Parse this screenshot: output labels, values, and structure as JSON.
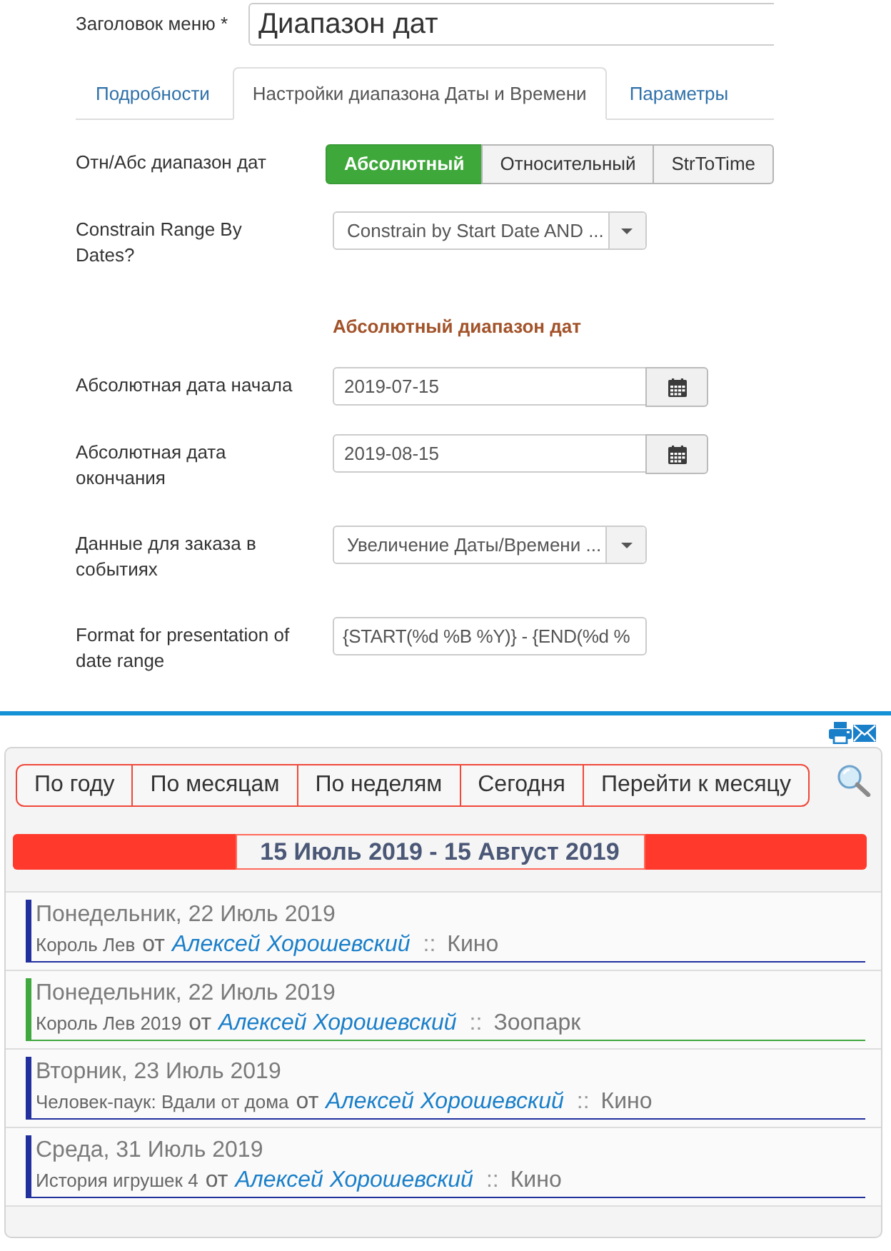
{
  "menu_title": {
    "label": "Заголовок меню *",
    "value": "Диапазон дат"
  },
  "tabs": [
    {
      "label": "Подробности",
      "selected": false
    },
    {
      "label": "Настройки диапазона Даты и Времени",
      "selected": true
    },
    {
      "label": "Параметры",
      "selected": false
    }
  ],
  "fields": [
    {
      "kind": "toggle",
      "label": "Отн/Абс диапазон дат",
      "options": [
        {
          "label": "Абсолютный",
          "selected": true
        },
        {
          "label": "Относительный",
          "selected": false
        },
        {
          "label": "StrToTime",
          "selected": false
        }
      ]
    },
    {
      "kind": "select",
      "label": "Constrain Range By Dates?",
      "value": "Constrain by Start Date AND ..."
    },
    {
      "kind": "heading",
      "text": "Абсолютный диапазон дат"
    },
    {
      "kind": "date",
      "label": "Абсолютная дата начала",
      "value": "2019-07-15"
    },
    {
      "kind": "date",
      "label": "Абсолютная дата окончания",
      "value": "2019-08-15"
    },
    {
      "kind": "select",
      "label": "Данные для заказа в событиях",
      "value": "Увеличение Даты/Времени ..."
    },
    {
      "kind": "text",
      "label": "Format for presentation of date range",
      "value": "{START(%d %B %Y)} - {END(%d %"
    }
  ],
  "calendar": {
    "nav": [
      "По году",
      "По месяцам",
      "По неделям",
      "Сегодня",
      "Перейти к месяцу"
    ],
    "range_title": "15 Июль 2019 - 15 Август 2019",
    "events": [
      {
        "date": "Понедельник, 22 Июль 2019",
        "title": "Король Лев",
        "by": "от",
        "author": "Алексей Хорошевский",
        "separator": "::",
        "category": "Кино",
        "color": "#22309e"
      },
      {
        "date": "Понедельник, 22 Июль 2019",
        "title": "Король Лев 2019",
        "by": "от",
        "author": "Алексей Хорошевский",
        "separator": "::",
        "category": "Зоопарк",
        "color": "#3fa83f"
      },
      {
        "date": "Вторник, 23 Июль 2019",
        "title": "Человек-паук: Вдали от дома",
        "by": "от",
        "author": "Алексей Хорошевский",
        "separator": "::",
        "category": "Кино",
        "color": "#22309e"
      },
      {
        "date": "Среда, 31 Июль 2019",
        "title": "История игрушек 4",
        "by": "от",
        "author": "Алексей Хорошевский",
        "separator": "::",
        "category": "Кино",
        "color": "#22309e"
      }
    ]
  }
}
